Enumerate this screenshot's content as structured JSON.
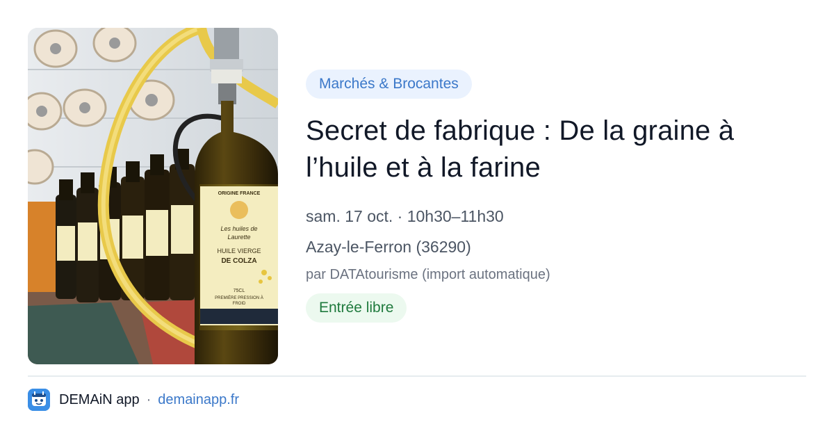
{
  "event": {
    "category": "Marchés & Brocantes",
    "title": "Secret de fabrique : De la graine à l’huile et à la farine",
    "datetime": "sam. 17 oct. · 10h30–11h30",
    "location": "Azay-le-Ferron (36290)",
    "author": "par DATAtourisme (import automatique)",
    "price": "Entrée libre"
  },
  "photo": {
    "label_origin": "ORIGINE FRANCE",
    "label_brand_line1": "Les huiles de",
    "label_brand_line2": "Laurette",
    "label_product_line1": "HUILE VIERGE",
    "label_product_line2": "DE COLZA",
    "label_volume": "75CL",
    "label_press_line1": "PREMIÈRE PRESSION À",
    "label_press_line2": "FROID"
  },
  "footer": {
    "app_name": "DEMAiN app",
    "separator": "·",
    "url": "demainapp.fr"
  },
  "colors": {
    "category_bg": "#eaf2fe",
    "category_text": "#3b78c9",
    "price_bg": "#ecf9ef",
    "price_text": "#1f7a3d",
    "link": "#3b78c9",
    "app_icon": "#3a8ee6"
  }
}
